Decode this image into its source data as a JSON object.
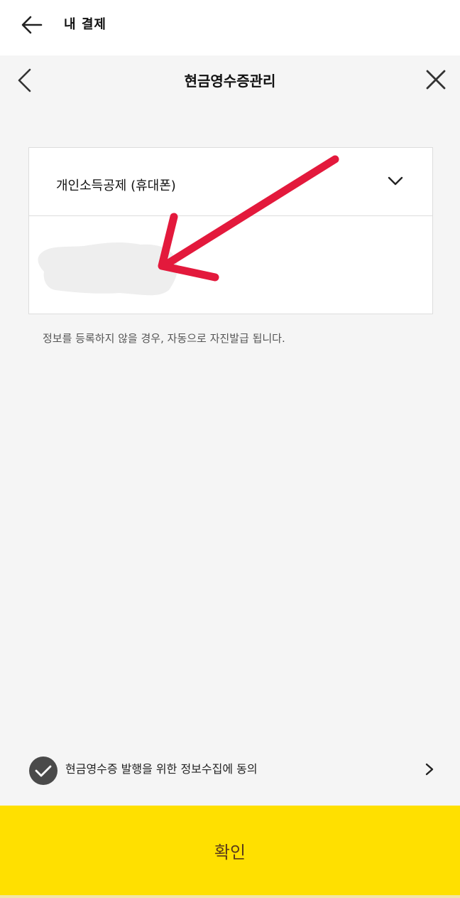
{
  "top_bar": {
    "title": "내 결제"
  },
  "nav_bar": {
    "title": "현금영수증관리"
  },
  "receipt_form": {
    "type_select_value": "개인소득공제 (휴대폰)",
    "phone_input_value": "",
    "notice": "정보를 등록하지 않을 경우, 자동으로 자진발급 됩니다."
  },
  "consent": {
    "label": "현금영수증 발행을 위한 정보수집에 동의",
    "checked": true
  },
  "confirm": {
    "label": "확인"
  },
  "colors": {
    "confirm_bg": "#ffe000",
    "confirm_text": "#5a3a1a",
    "arrow_annotation": "#e3193c",
    "check_bg": "#4a4a4a",
    "background": "#f5f5f5"
  },
  "icons": {
    "top_back": "arrow-left-icon",
    "nav_back": "chevron-left-icon",
    "nav_close": "close-icon",
    "select": "chevron-down-icon",
    "consent_check": "check-circle-icon",
    "consent_more": "chevron-right-icon"
  }
}
